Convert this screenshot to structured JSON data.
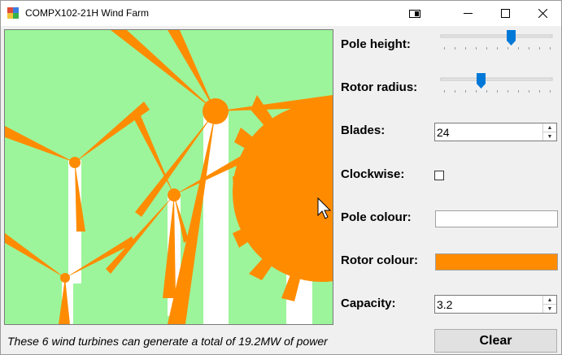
{
  "window": {
    "title": "COMPX102-21H Wind Farm",
    "buttons": [
      "snap-icon",
      "minimize-icon",
      "maximize-icon",
      "close-icon"
    ]
  },
  "controls": {
    "pole_height": {
      "label": "Pole height:",
      "value_fraction": 0.63
    },
    "rotor_radius": {
      "label": "Rotor radius:",
      "value_fraction": 0.36
    },
    "blades": {
      "label": "Blades:",
      "value": "24"
    },
    "clockwise": {
      "label": "Clockwise:",
      "checked": false
    },
    "pole_colour": {
      "label": "Pole colour:",
      "color": "#ffffff"
    },
    "rotor_colour": {
      "label": "Rotor colour:",
      "color": "#ff8c00"
    },
    "capacity": {
      "label": "Capacity:",
      "value": "3.2"
    },
    "clear_label": "Clear"
  },
  "status_text": "These 6 wind turbines can generate a total of 19.2MW of power",
  "colors": {
    "canvas_background": "#9cf59a",
    "rotor": "#ff8c00",
    "pole": "#ffffff",
    "slider_thumb": "#0078d7"
  }
}
